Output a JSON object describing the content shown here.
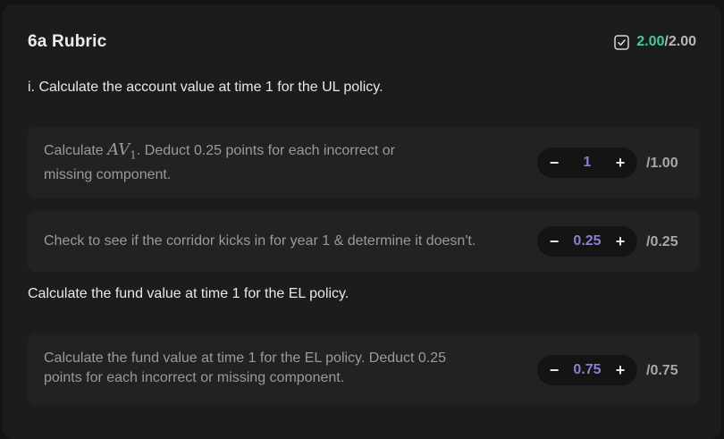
{
  "rubric": {
    "title": "6a Rubric",
    "score_earned": "2.00",
    "score_total": "/2.00",
    "score_icon": "checkbox-checked-icon",
    "earned_color": "#3ecf8e"
  },
  "sections": [
    {
      "text": "i. Calculate the account value at time 1 for the UL policy.",
      "criteria": [
        {
          "desc_prefix": "Calculate ",
          "math_base": "AV",
          "math_sub": "1",
          "desc_suffix": ". Deduct 0.25 points for each incorrect or",
          "desc_line2": "missing component.",
          "value": "1",
          "max": "/1.00",
          "minus": "−",
          "plus": "+"
        },
        {
          "desc": "Check to see if the corridor kicks in for year 1 & determine it doesn't.",
          "value": "0.25",
          "max": "/0.25",
          "minus": "−",
          "plus": "+"
        }
      ]
    },
    {
      "text": "Calculate the fund value at time 1 for the EL policy.",
      "criteria": [
        {
          "desc_line1": "Calculate the fund value at time 1 for the EL policy. Deduct 0.25",
          "desc_line2": "points for each incorrect or missing component.",
          "value": "0.75",
          "max": "/0.75",
          "minus": "−",
          "plus": "+"
        }
      ]
    }
  ]
}
